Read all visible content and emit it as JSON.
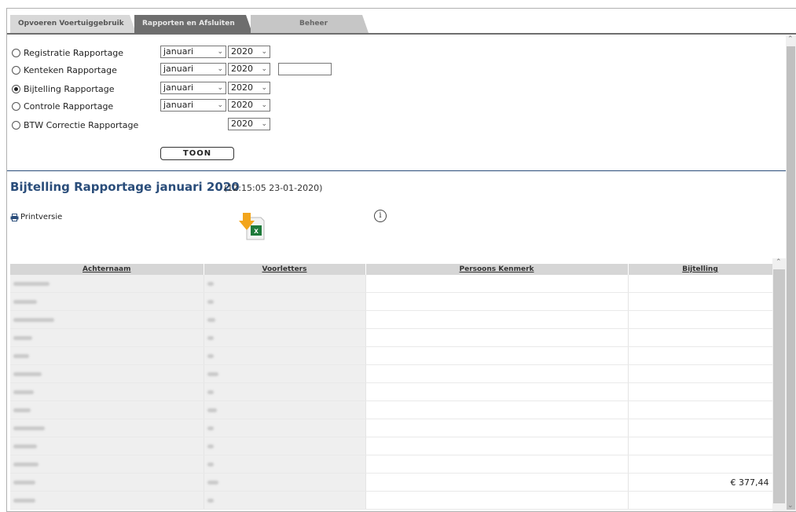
{
  "tabs": [
    {
      "label": "Opvoeren Voertuiggebruik"
    },
    {
      "label": "Rapporten en Afsluiten"
    },
    {
      "label": "Beheer"
    }
  ],
  "report_options": [
    {
      "label": "Registratie Rapportage",
      "selected": false,
      "month": "januari",
      "year": "2020"
    },
    {
      "label": "Kenteken Rapportage",
      "selected": false,
      "month": "januari",
      "year": "2020",
      "text_value": ""
    },
    {
      "label": "Bijtelling Rapportage",
      "selected": true,
      "month": "januari",
      "year": "2020"
    },
    {
      "label": "Controle Rapportage",
      "selected": false,
      "month": "januari",
      "year": "2020"
    },
    {
      "label": "BTW Correctie Rapportage",
      "selected": false,
      "year": "2020"
    }
  ],
  "toon_label": "TOON",
  "report": {
    "title": "Bijtelling Rapportage januari 2020",
    "timestamp": "(12:15:05 23-01-2020)",
    "print_label": "Printversie",
    "excel_icon": "excel-download-icon",
    "info_icon": "info-icon",
    "info_glyph": "i"
  },
  "table": {
    "columns": [
      "Achternaam",
      "Voorletters",
      "Persoons Kenmerk",
      "Bijtelling"
    ],
    "rows": [
      {
        "bijtelling": ""
      },
      {
        "bijtelling": ""
      },
      {
        "bijtelling": ""
      },
      {
        "bijtelling": ""
      },
      {
        "bijtelling": ""
      },
      {
        "bijtelling": ""
      },
      {
        "bijtelling": ""
      },
      {
        "bijtelling": ""
      },
      {
        "bijtelling": ""
      },
      {
        "bijtelling": ""
      },
      {
        "bijtelling": ""
      },
      {
        "bijtelling": "€ 377,44"
      },
      {
        "bijtelling": ""
      }
    ]
  }
}
